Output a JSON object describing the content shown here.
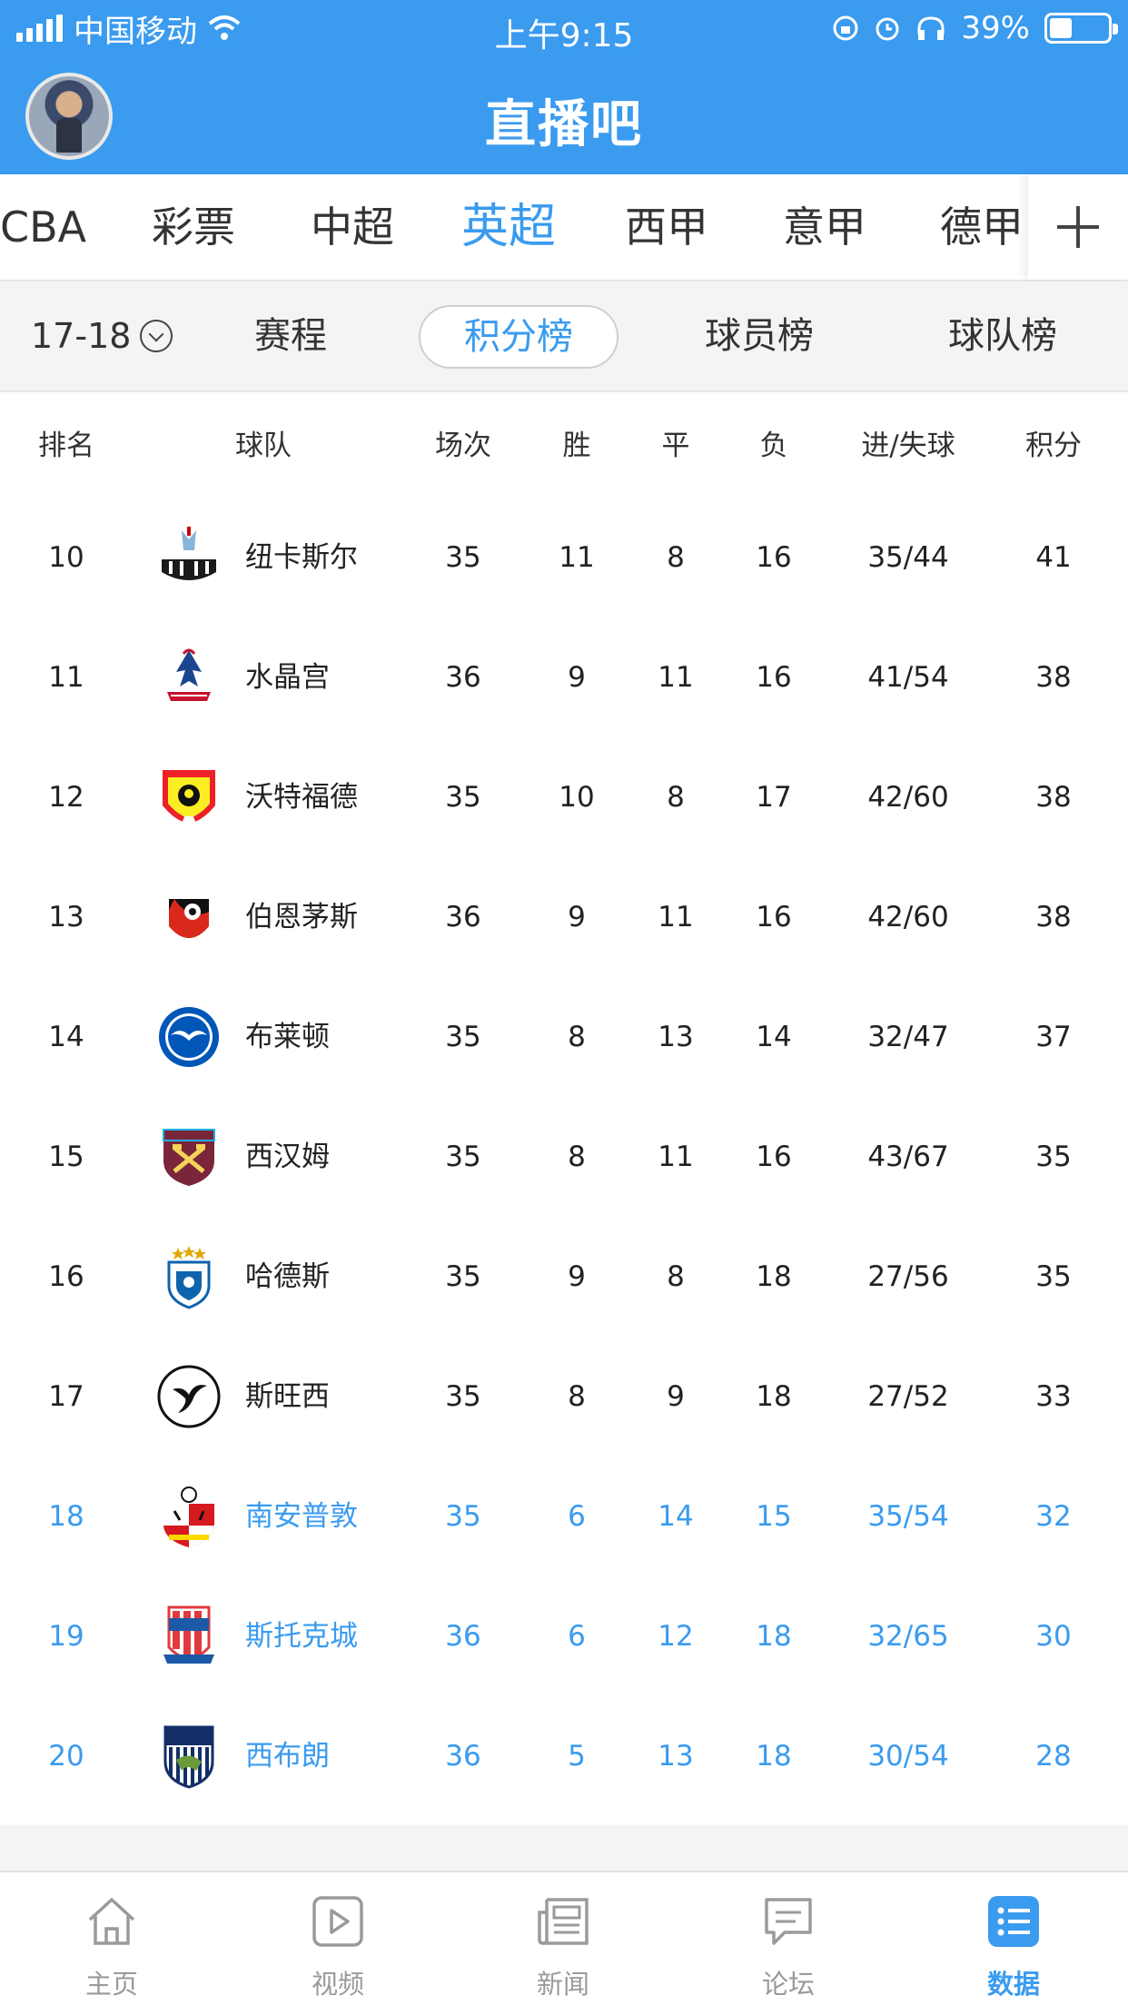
{
  "status_bar": {
    "carrier": "中国移动",
    "time": "上午9:15",
    "battery_percent": "39%",
    "battery_level": 0.39
  },
  "header": {
    "title": "直播吧"
  },
  "league_tabs": [
    {
      "label": "CBA"
    },
    {
      "label": "彩票"
    },
    {
      "label": "中超"
    },
    {
      "label": "英超",
      "active": true
    },
    {
      "label": "西甲"
    },
    {
      "label": "意甲"
    },
    {
      "label": "德甲"
    }
  ],
  "sub_tabs": {
    "season": "17-18",
    "items": [
      {
        "label": "赛程"
      },
      {
        "label": "积分榜",
        "active": true
      },
      {
        "label": "球员榜"
      },
      {
        "label": "球队榜"
      }
    ]
  },
  "table": {
    "headers": {
      "rank": "排名",
      "team": "球队",
      "played": "场次",
      "won": "胜",
      "drawn": "平",
      "lost": "负",
      "goals": "进/失球",
      "points": "积分"
    },
    "rows": [
      {
        "rank": "10",
        "team": "纽卡斯尔",
        "played": "35",
        "won": "11",
        "drawn": "8",
        "lost": "16",
        "goals": "35/44",
        "points": "41",
        "relegation": false,
        "crest": "newcastle-crest-icon"
      },
      {
        "rank": "11",
        "team": "水晶宫",
        "played": "36",
        "won": "9",
        "drawn": "11",
        "lost": "16",
        "goals": "41/54",
        "points": "38",
        "relegation": false,
        "crest": "crystal-palace-crest-icon"
      },
      {
        "rank": "12",
        "team": "沃特福德",
        "played": "35",
        "won": "10",
        "drawn": "8",
        "lost": "17",
        "goals": "42/60",
        "points": "38",
        "relegation": false,
        "crest": "watford-crest-icon"
      },
      {
        "rank": "13",
        "team": "伯恩茅斯",
        "played": "36",
        "won": "9",
        "drawn": "11",
        "lost": "16",
        "goals": "42/60",
        "points": "38",
        "relegation": false,
        "crest": "bournemouth-crest-icon"
      },
      {
        "rank": "14",
        "team": "布莱顿",
        "played": "35",
        "won": "8",
        "drawn": "13",
        "lost": "14",
        "goals": "32/47",
        "points": "37",
        "relegation": false,
        "crest": "brighton-crest-icon"
      },
      {
        "rank": "15",
        "team": "西汉姆",
        "played": "35",
        "won": "8",
        "drawn": "11",
        "lost": "16",
        "goals": "43/67",
        "points": "35",
        "relegation": false,
        "crest": "west-ham-crest-icon"
      },
      {
        "rank": "16",
        "team": "哈德斯",
        "played": "35",
        "won": "9",
        "drawn": "8",
        "lost": "18",
        "goals": "27/56",
        "points": "35",
        "relegation": false,
        "crest": "huddersfield-crest-icon"
      },
      {
        "rank": "17",
        "team": "斯旺西",
        "played": "35",
        "won": "8",
        "drawn": "9",
        "lost": "18",
        "goals": "27/52",
        "points": "33",
        "relegation": false,
        "crest": "swansea-crest-icon"
      },
      {
        "rank": "18",
        "team": "南安普敦",
        "played": "35",
        "won": "6",
        "drawn": "14",
        "lost": "15",
        "goals": "35/54",
        "points": "32",
        "relegation": true,
        "crest": "southampton-crest-icon"
      },
      {
        "rank": "19",
        "team": "斯托克城",
        "played": "36",
        "won": "6",
        "drawn": "12",
        "lost": "18",
        "goals": "32/65",
        "points": "30",
        "relegation": true,
        "crest": "stoke-crest-icon"
      },
      {
        "rank": "20",
        "team": "西布朗",
        "played": "36",
        "won": "5",
        "drawn": "13",
        "lost": "18",
        "goals": "30/54",
        "points": "28",
        "relegation": true,
        "crest": "west-brom-crest-icon"
      }
    ]
  },
  "bottom_nav": [
    {
      "label": "主页",
      "icon": "home-icon"
    },
    {
      "label": "视频",
      "icon": "video-icon"
    },
    {
      "label": "新闻",
      "icon": "news-icon"
    },
    {
      "label": "论坛",
      "icon": "forum-icon"
    },
    {
      "label": "数据",
      "icon": "data-icon",
      "active": true
    }
  ],
  "colors": {
    "accent": "#3a9bef",
    "relegation_text": "#3a9bef",
    "inactive_nav": "#9a9a9a"
  }
}
